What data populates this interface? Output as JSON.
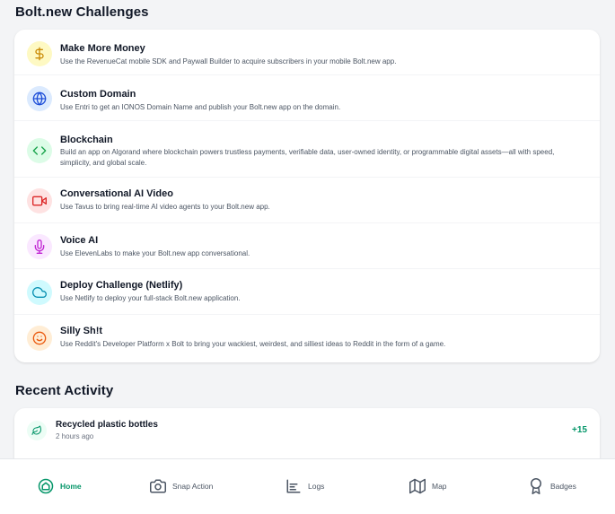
{
  "challenges": {
    "title": "Bolt.new Challenges",
    "items": [
      {
        "title": "Make More Money",
        "description": "Use the RevenueCat mobile SDK and Paywall Builder to acquire subscribers in your mobile Bolt.new app.",
        "icon": "dollar-icon",
        "color": "#ca8a04",
        "bg": "#fef9c3"
      },
      {
        "title": "Custom Domain",
        "description": "Use Entri to get an IONOS Domain Name and publish your Bolt.new app on the domain.",
        "icon": "globe-icon",
        "color": "#1d4ed8",
        "bg": "#dbeafe"
      },
      {
        "title": "Blockchain",
        "description": "Build an app on Algorand where blockchain powers trustless payments, verifiable data, user-owned identity, or programmable digital assets—all with speed, simplicity, and global scale.",
        "icon": "code-icon",
        "color": "#16a34a",
        "bg": "#dcfce7"
      },
      {
        "title": "Conversational AI Video",
        "description": "Use Tavus to bring real-time AI video agents to your Bolt.new app.",
        "icon": "video-icon",
        "color": "#dc2626",
        "bg": "#fee2e2"
      },
      {
        "title": "Voice AI",
        "description": "Use ElevenLabs to make your Bolt.new app conversational.",
        "icon": "microphone-icon",
        "color": "#c026d3",
        "bg": "#fae8ff"
      },
      {
        "title": "Deploy Challenge (Netlify)",
        "description": "Use Netlify to deploy your full-stack Bolt.new application.",
        "icon": "cloud-icon",
        "color": "#0891b2",
        "bg": "#cffafe"
      },
      {
        "title": "Silly Sh!t",
        "description": "Use Reddit's Developer Platform x Bolt to bring your wackiest, weirdest, and silliest ideas to Reddit in the form of a game.",
        "icon": "smile-icon",
        "color": "#ea580c",
        "bg": "#ffedd5"
      }
    ]
  },
  "activity": {
    "title": "Recent Activity",
    "items": [
      {
        "title": "Recycled plastic bottles",
        "time": "2 hours ago",
        "points": "+15",
        "icon": "leaf-icon"
      }
    ]
  },
  "nav": {
    "items": [
      {
        "label": "Home",
        "icon": "home-icon",
        "active": true
      },
      {
        "label": "Snap Action",
        "icon": "camera-icon",
        "active": false
      },
      {
        "label": "Logs",
        "icon": "chart-icon",
        "active": false
      },
      {
        "label": "Map",
        "icon": "map-icon",
        "active": false
      },
      {
        "label": "Badges",
        "icon": "award-icon",
        "active": false
      }
    ]
  },
  "colors": {
    "accent": "#059669",
    "background": "#f3f4f6",
    "card": "#ffffff"
  }
}
